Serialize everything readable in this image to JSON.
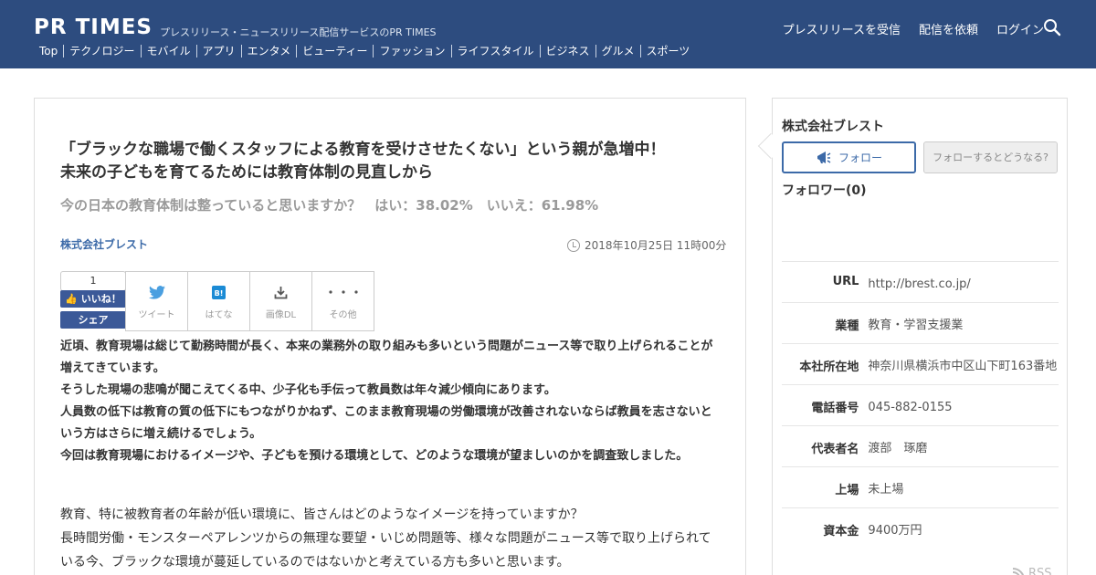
{
  "header": {
    "logo": "PR TIMES",
    "tagline": "プレスリリース・ニュースリリース配信サービスのPR TIMES",
    "nav": [
      "プレスリリースを受信",
      "配信を依頼",
      "ログイン"
    ],
    "categories": [
      "Top",
      "テクノロジー",
      "モバイル",
      "アプリ",
      "エンタメ",
      "ビューティー",
      "ファッション",
      "ライフスタイル",
      "ビジネス",
      "グルメ",
      "スポーツ"
    ]
  },
  "article": {
    "title_line1": "「ブラックな職場で働くスタッフによる教育を受けさせたくない」という親が急増中！",
    "title_line2": "未来の子どもを育てるためには教育体制の見直しから",
    "subtitle": "今の日本の教育体制は整っていると思いますか？　はい：38.02%　いいえ：61.98%",
    "company": "株式会社ブレスト",
    "date": "2018年10月25日 11時00分",
    "like_count": "1",
    "like_label": "いいね！",
    "share_label": "シェア",
    "buttons": [
      "ツイート",
      "はてな",
      "画像DL",
      "その他"
    ],
    "lead": [
      "近頃、教育現場は総じて勤務時間が長く、本来の業務外の取り組みも多いという問題がニュース等で取り上げられることが増えてきています。",
      "そうした現場の悲鳴が聞こえてくる中、少子化も手伝って教員数は年々減少傾向にあります。",
      "人員数の低下は教育の質の低下にもつながりかねず、このまま教育現場の労働環境が改善されないならば教員を志さないという方はさらに増え続けるでしょう。",
      "今回は教育現場におけるイメージや、子どもを預ける環境として、どのような環境が望ましいのかを調査致しました。"
    ],
    "body": [
      "教育、特に被教育者の年齢が低い環境に、皆さんはどのようなイメージを持っていますか？",
      "長時間労働・モンスターペアレンツからの無理な要望・いじめ問題等、様々な問題がニュース等で取り上げられている今、ブラックな環境が蔓延しているのではないかと考えている方も多いと思います。"
    ]
  },
  "sidebar": {
    "company": "株式会社ブレスト",
    "follow": "フォロー",
    "follow_what": "フォローするとどうなる?",
    "followers": "フォロワー(0)",
    "info": [
      {
        "k": "URL",
        "v": "http://brest.co.jp/"
      },
      {
        "k": "業種",
        "v": "教育・学習支援業"
      },
      {
        "k": "本社所在地",
        "v": "神奈川県横浜市中区山下町163番地"
      },
      {
        "k": "電話番号",
        "v": "045-882-0155"
      },
      {
        "k": "代表者名",
        "v": "渡部　琢磨"
      },
      {
        "k": "上場",
        "v": "未上場"
      },
      {
        "k": "資本金",
        "v": "9400万円"
      }
    ],
    "rss": "RSS"
  },
  "colors": {
    "header_bg": "#2d4c7f",
    "link": "#3c6aa8",
    "facebook": "#3b5998"
  }
}
